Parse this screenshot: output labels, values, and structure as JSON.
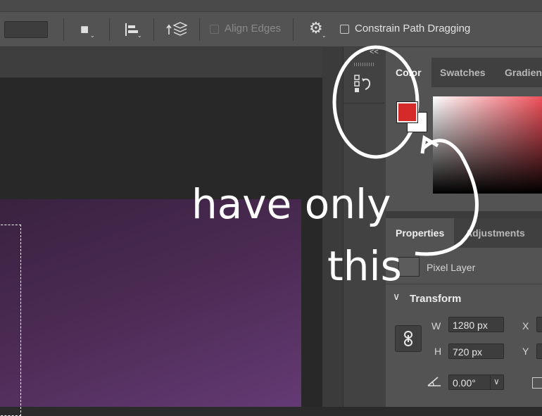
{
  "options_bar": {
    "align_edges_label": "Align Edges",
    "constrain_label": "Constrain Path Dragging",
    "icons": [
      "square-fill-icon",
      "align-left-icon",
      "arrange-layers-icon",
      "gear-icon"
    ],
    "dropdown_mark": "⌄"
  },
  "dock": {
    "collapse_glyph": "<<",
    "icon": "history-icon"
  },
  "color_panel": {
    "tabs": [
      "Color",
      "Swatches",
      "Gradients"
    ],
    "active_tab": "Color",
    "foreground_color": "#d42a2a",
    "background_color": "#ffffff"
  },
  "properties_panel": {
    "tabs": [
      "Properties",
      "Adjustments"
    ],
    "active_tab": "Properties",
    "layer_type": "Pixel Layer",
    "section": "Transform",
    "w_label": "W",
    "w_value": "1280 px",
    "h_label": "H",
    "h_value": "720 px",
    "x_label": "X",
    "y_label": "Y",
    "angle_value": "0.00°",
    "link_icon": "link-icon",
    "angle_icon": "angle-icon"
  },
  "annotation": {
    "line1": "have only",
    "line2": "this"
  }
}
